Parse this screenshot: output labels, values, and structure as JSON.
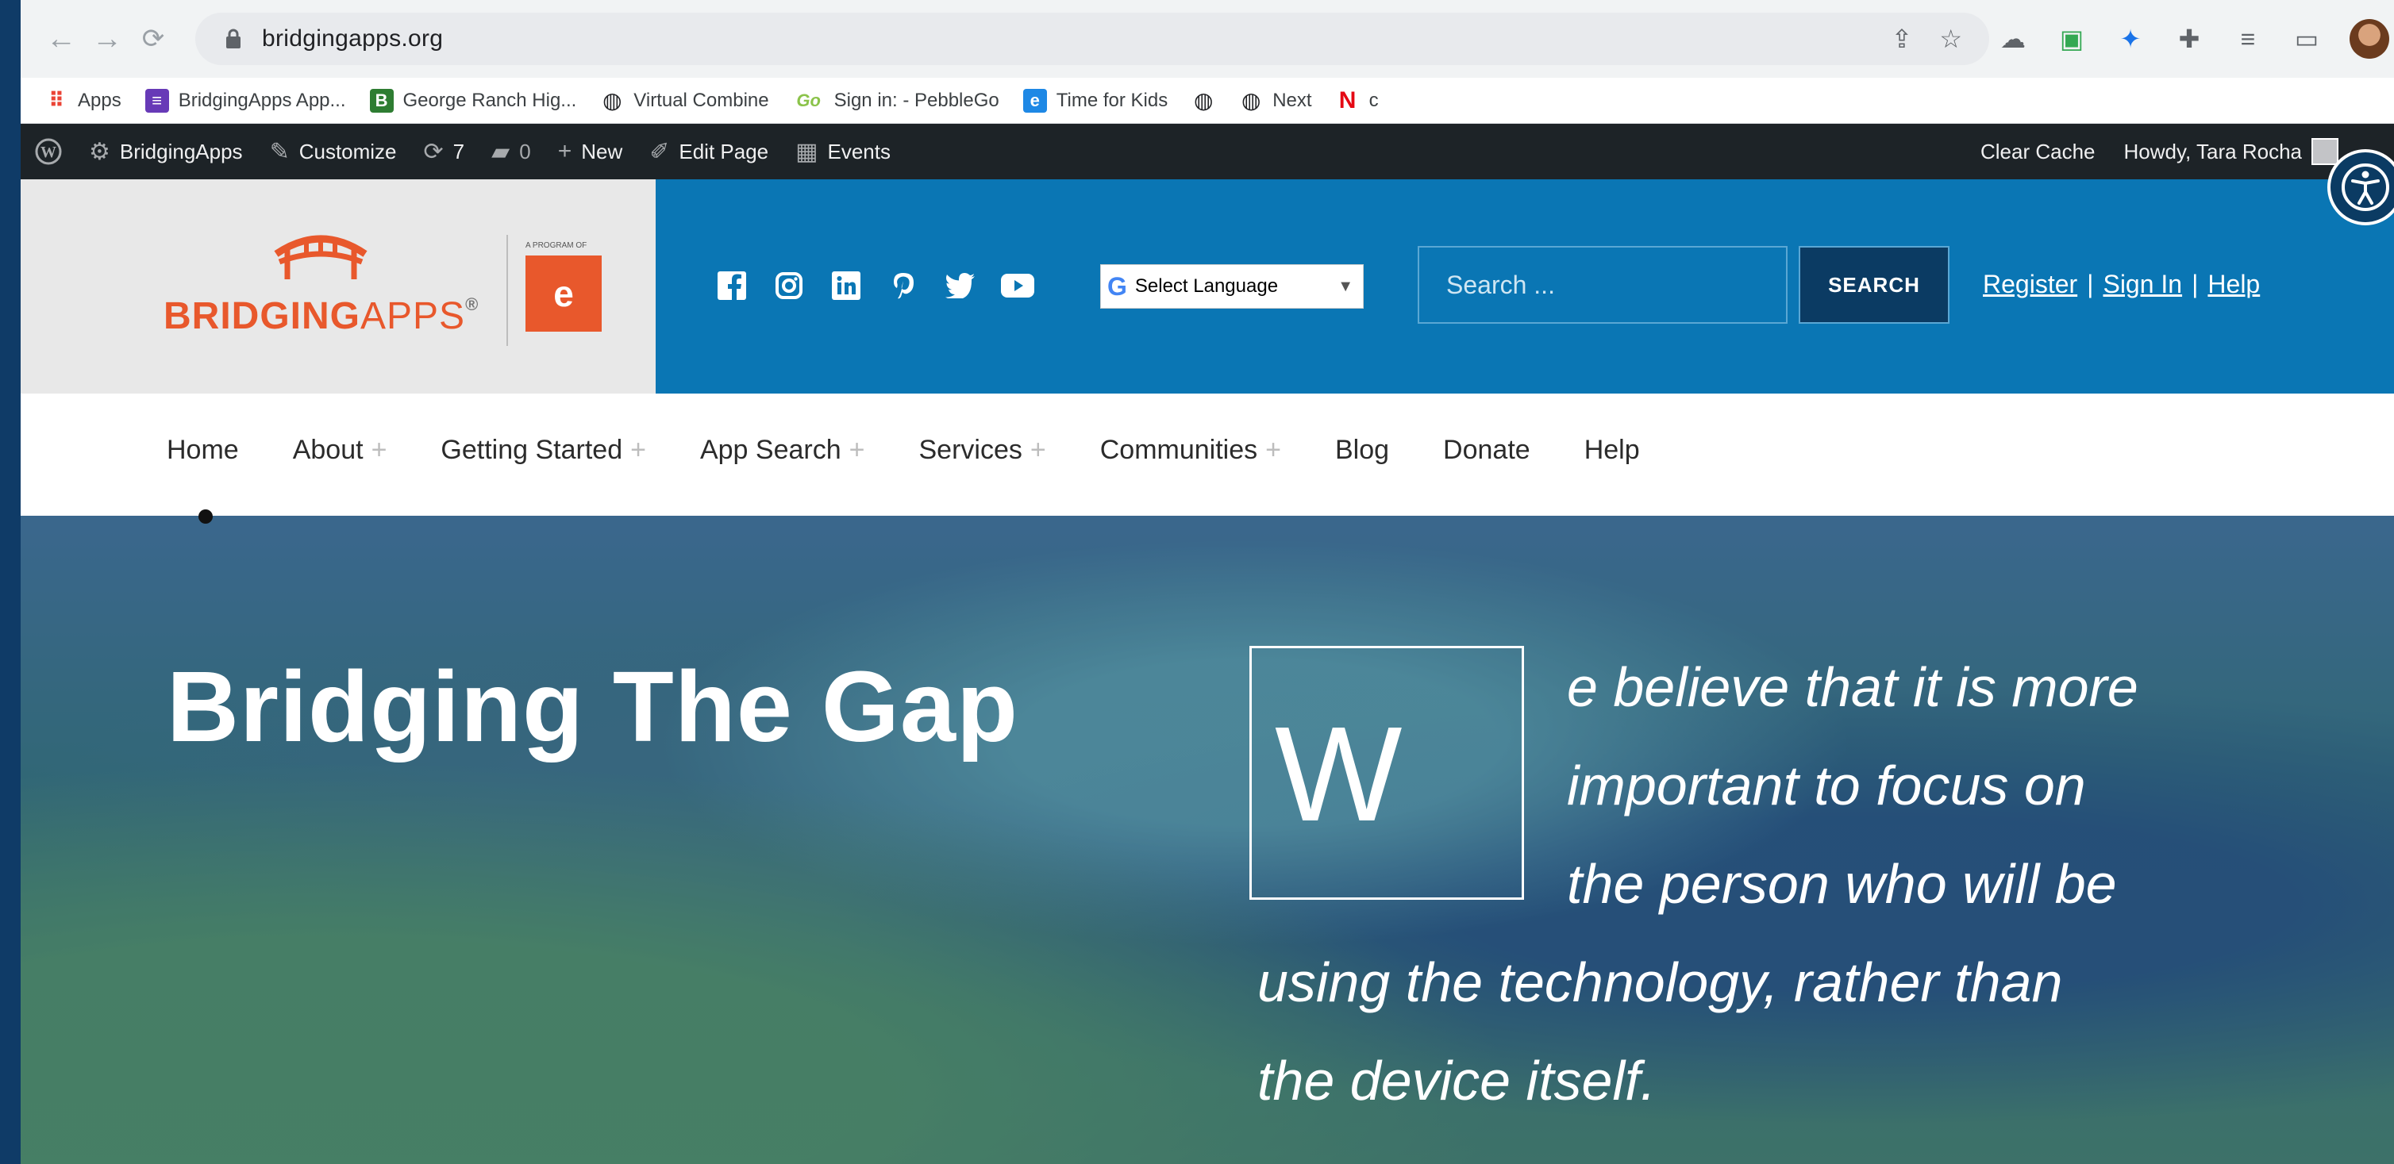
{
  "browser": {
    "url": "bridgingapps.org",
    "bookmarks": [
      {
        "label": "Apps",
        "icon": "apps-grid-icon",
        "color": "#ea4335"
      },
      {
        "label": "BridgingApps App...",
        "icon": "doc-icon",
        "color": "#673ab7"
      },
      {
        "label": "George Ranch Hig...",
        "icon": "b-icon",
        "color": "#2e7d32"
      },
      {
        "label": "Virtual Combine",
        "icon": "globe-icon",
        "color": "#202124"
      },
      {
        "label": "Sign in: - PebbleGo",
        "icon": "go-icon",
        "color": "#8bc34a"
      },
      {
        "label": "Time for Kids",
        "icon": "e-icon",
        "color": "#1e88e5"
      },
      {
        "label": "",
        "icon": "globe-icon",
        "color": "#202124"
      },
      {
        "label": "Next",
        "icon": "globe-icon",
        "color": "#202124"
      },
      {
        "label": "c",
        "icon": "netflix-icon",
        "color": "#e50914"
      }
    ]
  },
  "wpbar": {
    "site": "BridgingApps",
    "customize": "Customize",
    "updates": "7",
    "comments": "0",
    "new": "New",
    "edit": "Edit Page",
    "events": "Events",
    "clear_cache": "Clear Cache",
    "howdy": "Howdy, Tara Rocha"
  },
  "header": {
    "logo_part1": "BRIDGING",
    "logo_part2": "APPS",
    "logo_mark": "®",
    "es_label": "A PROGRAM OF",
    "language": "Select Language",
    "search_placeholder": "Search ...",
    "search_button": "SEARCH",
    "register": "Register",
    "signin": "Sign In",
    "help": "Help",
    "sep": "|"
  },
  "nav": {
    "items": [
      {
        "label": "Home",
        "plus": ""
      },
      {
        "label": "About",
        "plus": "+"
      },
      {
        "label": "Getting Started",
        "plus": "+"
      },
      {
        "label": "App Search",
        "plus": "+"
      },
      {
        "label": "Services",
        "plus": "+"
      },
      {
        "label": "Communities",
        "plus": "+"
      },
      {
        "label": "Blog",
        "plus": ""
      },
      {
        "label": "Donate",
        "plus": ""
      },
      {
        "label": "Help",
        "plus": ""
      }
    ]
  },
  "hero": {
    "title": "Bridging The Gap",
    "dropcap": "W",
    "line1": "e believe that it is more",
    "line2": "important to focus on",
    "line3": "the person who will be",
    "line4": "using the technology, rather than",
    "line5": "the device itself."
  },
  "colors": {
    "page_bg": "#0f3b67",
    "header_blue": "#0a76b4",
    "brand_orange": "#e8582c",
    "wpbar": "#1d2327"
  }
}
